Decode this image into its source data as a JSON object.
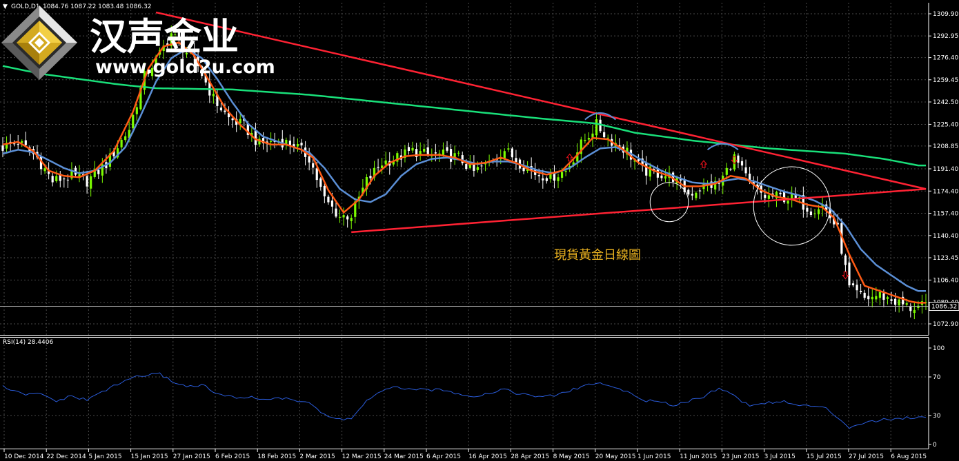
{
  "header": {
    "arrow": "▼",
    "symbol": "GOLD,D1",
    "ohlc": "1084.76 1087.22 1083.48 1086.32"
  },
  "brand": {
    "name_cn": "汉声金业",
    "url": "www.gold2u.com",
    "logo_icon": "diamond-logo-icon"
  },
  "annotation": {
    "text": "現貨黃金日線圖",
    "color": "#e8b020"
  },
  "rsi_header": "RSI(14) 28.4406",
  "current_price_label": "1086.32",
  "colors": {
    "bg": "#000000",
    "grid": "#4a4a4a",
    "bull": "#7cfc00",
    "bear": "#ffffff",
    "ma_fast": "#ff5a14",
    "ma_mid": "#5b8fd6",
    "ma_slow": "#19e07a",
    "trend": "#ff2233",
    "rsi": "#2a5cdc"
  },
  "chart_data": [
    {
      "type": "candlestick",
      "title": "",
      "x_tick_labels": [
        "10 Dec 2014",
        "22 Dec 2014",
        "5 Jan 2015",
        "15 Jan 2015",
        "27 Jan 2015",
        "6 Feb 2015",
        "18 Feb 2015",
        "2 Mar 2015",
        "12 Mar 2015",
        "24 Mar 2015",
        "6 Apr 2015",
        "16 Apr 2015",
        "28 Apr 2015",
        "8 May 2015",
        "20 May 2015",
        "1 Jun 2015",
        "11 Jun 2015",
        "23 Jun 2015",
        "3 Jul 2015",
        "15 Jul 2015",
        "27 Jul 2015",
        "6 Aug 2015"
      ],
      "y_tick_labels": [
        "1309.90",
        "1292.95",
        "1276.40",
        "1259.45",
        "1242.50",
        "1225.40",
        "1208.85",
        "1191.40",
        "1174.40",
        "1157.40",
        "1140.40",
        "1123.45",
        "1106.40",
        "1089.40",
        "1072.90"
      ],
      "ylim": [
        1066,
        1316
      ],
      "close_anchors": [
        {
          "x": 0,
          "y": 1208
        },
        {
          "x": 4,
          "y": 1212
        },
        {
          "x": 9,
          "y": 1200
        },
        {
          "x": 13,
          "y": 1182
        },
        {
          "x": 18,
          "y": 1186
        },
        {
          "x": 22,
          "y": 1182
        },
        {
          "x": 27,
          "y": 1195
        },
        {
          "x": 33,
          "y": 1222
        },
        {
          "x": 37,
          "y": 1262
        },
        {
          "x": 41,
          "y": 1279
        },
        {
          "x": 44,
          "y": 1295
        },
        {
          "x": 47,
          "y": 1284
        },
        {
          "x": 51,
          "y": 1270
        },
        {
          "x": 55,
          "y": 1245
        },
        {
          "x": 59,
          "y": 1230
        },
        {
          "x": 63,
          "y": 1224
        },
        {
          "x": 67,
          "y": 1210
        },
        {
          "x": 72,
          "y": 1213
        },
        {
          "x": 76,
          "y": 1210
        },
        {
          "x": 80,
          "y": 1200
        },
        {
          "x": 84,
          "y": 1168
        },
        {
          "x": 88,
          "y": 1155
        },
        {
          "x": 91,
          "y": 1156
        },
        {
          "x": 95,
          "y": 1182
        },
        {
          "x": 99,
          "y": 1196
        },
        {
          "x": 103,
          "y": 1200
        },
        {
          "x": 107,
          "y": 1205
        },
        {
          "x": 111,
          "y": 1202
        },
        {
          "x": 115,
          "y": 1202
        },
        {
          "x": 119,
          "y": 1200
        },
        {
          "x": 123,
          "y": 1189
        },
        {
          "x": 127,
          "y": 1196
        },
        {
          "x": 131,
          "y": 1206
        },
        {
          "x": 135,
          "y": 1196
        },
        {
          "x": 139,
          "y": 1188
        },
        {
          "x": 143,
          "y": 1185
        },
        {
          "x": 147,
          "y": 1190
        },
        {
          "x": 151,
          "y": 1210
        },
        {
          "x": 155,
          "y": 1225
        },
        {
          "x": 158,
          "y": 1215
        },
        {
          "x": 163,
          "y": 1205
        },
        {
          "x": 167,
          "y": 1190
        },
        {
          "x": 171,
          "y": 1188
        },
        {
          "x": 175,
          "y": 1185
        },
        {
          "x": 179,
          "y": 1172
        },
        {
          "x": 183,
          "y": 1178
        },
        {
          "x": 187,
          "y": 1180
        },
        {
          "x": 191,
          "y": 1200
        },
        {
          "x": 195,
          "y": 1180
        },
        {
          "x": 199,
          "y": 1170
        },
        {
          "x": 203,
          "y": 1170
        },
        {
          "x": 207,
          "y": 1168
        },
        {
          "x": 211,
          "y": 1160
        },
        {
          "x": 214,
          "y": 1164
        },
        {
          "x": 218,
          "y": 1145
        },
        {
          "x": 221,
          "y": 1100
        },
        {
          "x": 225,
          "y": 1092
        },
        {
          "x": 229,
          "y": 1095
        },
        {
          "x": 233,
          "y": 1090
        },
        {
          "x": 237,
          "y": 1085
        },
        {
          "x": 239,
          "y": 1086
        }
      ],
      "ma_fast_anchors": [
        {
          "x": 0,
          "y": 1210
        },
        {
          "x": 4,
          "y": 1212
        },
        {
          "x": 8,
          "y": 1205
        },
        {
          "x": 12,
          "y": 1190
        },
        {
          "x": 16,
          "y": 1186
        },
        {
          "x": 20,
          "y": 1185
        },
        {
          "x": 24,
          "y": 1190
        },
        {
          "x": 29,
          "y": 1205
        },
        {
          "x": 34,
          "y": 1235
        },
        {
          "x": 38,
          "y": 1268
        },
        {
          "x": 42,
          "y": 1285
        },
        {
          "x": 46,
          "y": 1288
        },
        {
          "x": 50,
          "y": 1278
        },
        {
          "x": 54,
          "y": 1258
        },
        {
          "x": 58,
          "y": 1238
        },
        {
          "x": 62,
          "y": 1225
        },
        {
          "x": 66,
          "y": 1214
        },
        {
          "x": 70,
          "y": 1210
        },
        {
          "x": 74,
          "y": 1210
        },
        {
          "x": 78,
          "y": 1206
        },
        {
          "x": 81,
          "y": 1200
        },
        {
          "x": 85,
          "y": 1175
        },
        {
          "x": 89,
          "y": 1158
        },
        {
          "x": 93,
          "y": 1168
        },
        {
          "x": 97,
          "y": 1186
        },
        {
          "x": 101,
          "y": 1196
        },
        {
          "x": 105,
          "y": 1201
        },
        {
          "x": 109,
          "y": 1202
        },
        {
          "x": 114,
          "y": 1202
        },
        {
          "x": 118,
          "y": 1200
        },
        {
          "x": 122,
          "y": 1195
        },
        {
          "x": 126,
          "y": 1196
        },
        {
          "x": 130,
          "y": 1200
        },
        {
          "x": 134,
          "y": 1196
        },
        {
          "x": 138,
          "y": 1190
        },
        {
          "x": 142,
          "y": 1187
        },
        {
          "x": 146,
          "y": 1190
        },
        {
          "x": 150,
          "y": 1202
        },
        {
          "x": 154,
          "y": 1215
        },
        {
          "x": 158,
          "y": 1214
        },
        {
          "x": 162,
          "y": 1206
        },
        {
          "x": 166,
          "y": 1196
        },
        {
          "x": 170,
          "y": 1190
        },
        {
          "x": 174,
          "y": 1186
        },
        {
          "x": 178,
          "y": 1178
        },
        {
          "x": 182,
          "y": 1178
        },
        {
          "x": 186,
          "y": 1180
        },
        {
          "x": 190,
          "y": 1186
        },
        {
          "x": 194,
          "y": 1184
        },
        {
          "x": 198,
          "y": 1175
        },
        {
          "x": 202,
          "y": 1170
        },
        {
          "x": 206,
          "y": 1168
        },
        {
          "x": 210,
          "y": 1164
        },
        {
          "x": 214,
          "y": 1162
        },
        {
          "x": 217,
          "y": 1154
        },
        {
          "x": 221,
          "y": 1126
        },
        {
          "x": 225,
          "y": 1102
        },
        {
          "x": 229,
          "y": 1098
        },
        {
          "x": 233,
          "y": 1094
        },
        {
          "x": 237,
          "y": 1090
        },
        {
          "x": 239,
          "y": 1089
        }
      ],
      "ma_mid_anchors": [
        {
          "x": 0,
          "y": 1203
        },
        {
          "x": 4,
          "y": 1206
        },
        {
          "x": 8,
          "y": 1204
        },
        {
          "x": 12,
          "y": 1198
        },
        {
          "x": 16,
          "y": 1192
        },
        {
          "x": 20,
          "y": 1188
        },
        {
          "x": 24,
          "y": 1190
        },
        {
          "x": 28,
          "y": 1196
        },
        {
          "x": 32,
          "y": 1208
        },
        {
          "x": 36,
          "y": 1232
        },
        {
          "x": 40,
          "y": 1258
        },
        {
          "x": 44,
          "y": 1276
        },
        {
          "x": 48,
          "y": 1283
        },
        {
          "x": 52,
          "y": 1276
        },
        {
          "x": 56,
          "y": 1260
        },
        {
          "x": 60,
          "y": 1242
        },
        {
          "x": 64,
          "y": 1226
        },
        {
          "x": 68,
          "y": 1216
        },
        {
          "x": 72,
          "y": 1212
        },
        {
          "x": 76,
          "y": 1208
        },
        {
          "x": 80,
          "y": 1204
        },
        {
          "x": 84,
          "y": 1192
        },
        {
          "x": 88,
          "y": 1176
        },
        {
          "x": 92,
          "y": 1168
        },
        {
          "x": 96,
          "y": 1166
        },
        {
          "x": 100,
          "y": 1172
        },
        {
          "x": 104,
          "y": 1186
        },
        {
          "x": 108,
          "y": 1195
        },
        {
          "x": 112,
          "y": 1199
        },
        {
          "x": 116,
          "y": 1200
        },
        {
          "x": 120,
          "y": 1198
        },
        {
          "x": 124,
          "y": 1195
        },
        {
          "x": 128,
          "y": 1197
        },
        {
          "x": 132,
          "y": 1197
        },
        {
          "x": 136,
          "y": 1194
        },
        {
          "x": 140,
          "y": 1190
        },
        {
          "x": 144,
          "y": 1188
        },
        {
          "x": 148,
          "y": 1192
        },
        {
          "x": 152,
          "y": 1200
        },
        {
          "x": 156,
          "y": 1207
        },
        {
          "x": 160,
          "y": 1208
        },
        {
          "x": 164,
          "y": 1203
        },
        {
          "x": 168,
          "y": 1196
        },
        {
          "x": 172,
          "y": 1190
        },
        {
          "x": 176,
          "y": 1185
        },
        {
          "x": 180,
          "y": 1181
        },
        {
          "x": 184,
          "y": 1180
        },
        {
          "x": 188,
          "y": 1182
        },
        {
          "x": 192,
          "y": 1184
        },
        {
          "x": 196,
          "y": 1182
        },
        {
          "x": 200,
          "y": 1178
        },
        {
          "x": 204,
          "y": 1174
        },
        {
          "x": 208,
          "y": 1171
        },
        {
          "x": 212,
          "y": 1167
        },
        {
          "x": 216,
          "y": 1161
        },
        {
          "x": 220,
          "y": 1148
        },
        {
          "x": 224,
          "y": 1130
        },
        {
          "x": 228,
          "y": 1118
        },
        {
          "x": 232,
          "y": 1110
        },
        {
          "x": 236,
          "y": 1102
        },
        {
          "x": 239,
          "y": 1098
        }
      ],
      "ma_slow_anchors": [
        {
          "x": 0,
          "y": 1270
        },
        {
          "x": 10,
          "y": 1264
        },
        {
          "x": 20,
          "y": 1260
        },
        {
          "x": 30,
          "y": 1256
        },
        {
          "x": 40,
          "y": 1253
        },
        {
          "x": 60,
          "y": 1252
        },
        {
          "x": 80,
          "y": 1248
        },
        {
          "x": 100,
          "y": 1242
        },
        {
          "x": 120,
          "y": 1236
        },
        {
          "x": 140,
          "y": 1230
        },
        {
          "x": 155,
          "y": 1226
        },
        {
          "x": 165,
          "y": 1219
        },
        {
          "x": 180,
          "y": 1213
        },
        {
          "x": 190,
          "y": 1210
        },
        {
          "x": 200,
          "y": 1207
        },
        {
          "x": 210,
          "y": 1205
        },
        {
          "x": 220,
          "y": 1203
        },
        {
          "x": 230,
          "y": 1199
        },
        {
          "x": 239,
          "y": 1194
        }
      ],
      "trendlines": [
        {
          "x1": 40,
          "y1": 1311,
          "x2": 241,
          "y2": 1176
        },
        {
          "x1": 91,
          "y1": 1143,
          "x2": 241,
          "y2": 1176
        }
      ],
      "ellipses": [
        {
          "cx": 174,
          "cy": 1166,
          "rx": 5,
          "ry": 15
        },
        {
          "cx": 206,
          "cy": 1163,
          "rx": 10,
          "ry": 30
        }
      ],
      "arcs": [
        {
          "x1": 152,
          "y1": 1229,
          "xm": 156,
          "ym": 1236,
          "x2": 160,
          "y2": 1229
        },
        {
          "x1": 184,
          "y1": 1206,
          "xm": 188,
          "ym": 1212,
          "x2": 192,
          "y2": 1206
        }
      ],
      "signal_arrows": [
        {
          "x": 148,
          "y": 1200,
          "dir": "up"
        },
        {
          "x": 183,
          "y": 1195,
          "dir": "up"
        },
        {
          "x": 191,
          "y": 1198,
          "dir": "down"
        },
        {
          "x": 220,
          "y": 1110,
          "dir": "down"
        }
      ]
    },
    {
      "type": "line",
      "title": "",
      "y_tick_labels": [
        "100",
        "70",
        "30",
        "0"
      ],
      "ylim": [
        0,
        100
      ],
      "values": [
        {
          "x": 0,
          "y": 60
        },
        {
          "x": 5,
          "y": 52
        },
        {
          "x": 10,
          "y": 52
        },
        {
          "x": 14,
          "y": 45
        },
        {
          "x": 18,
          "y": 50
        },
        {
          "x": 22,
          "y": 46
        },
        {
          "x": 26,
          "y": 55
        },
        {
          "x": 30,
          "y": 62
        },
        {
          "x": 34,
          "y": 70
        },
        {
          "x": 38,
          "y": 72
        },
        {
          "x": 41,
          "y": 73
        },
        {
          "x": 44,
          "y": 66
        },
        {
          "x": 48,
          "y": 60
        },
        {
          "x": 52,
          "y": 62
        },
        {
          "x": 56,
          "y": 52
        },
        {
          "x": 60,
          "y": 49
        },
        {
          "x": 64,
          "y": 49
        },
        {
          "x": 68,
          "y": 47
        },
        {
          "x": 72,
          "y": 48
        },
        {
          "x": 76,
          "y": 46
        },
        {
          "x": 80,
          "y": 44
        },
        {
          "x": 84,
          "y": 30
        },
        {
          "x": 88,
          "y": 26
        },
        {
          "x": 91,
          "y": 27
        },
        {
          "x": 95,
          "y": 45
        },
        {
          "x": 99,
          "y": 55
        },
        {
          "x": 103,
          "y": 60
        },
        {
          "x": 107,
          "y": 56
        },
        {
          "x": 111,
          "y": 57
        },
        {
          "x": 115,
          "y": 56
        },
        {
          "x": 119,
          "y": 53
        },
        {
          "x": 123,
          "y": 50
        },
        {
          "x": 127,
          "y": 53
        },
        {
          "x": 131,
          "y": 58
        },
        {
          "x": 135,
          "y": 52
        },
        {
          "x": 139,
          "y": 50
        },
        {
          "x": 143,
          "y": 50
        },
        {
          "x": 147,
          "y": 54
        },
        {
          "x": 151,
          "y": 60
        },
        {
          "x": 155,
          "y": 64
        },
        {
          "x": 158,
          "y": 61
        },
        {
          "x": 163,
          "y": 55
        },
        {
          "x": 167,
          "y": 46
        },
        {
          "x": 171,
          "y": 44
        },
        {
          "x": 175,
          "y": 41
        },
        {
          "x": 179,
          "y": 45
        },
        {
          "x": 183,
          "y": 50
        },
        {
          "x": 187,
          "y": 59
        },
        {
          "x": 191,
          "y": 50
        },
        {
          "x": 195,
          "y": 40
        },
        {
          "x": 199,
          "y": 43
        },
        {
          "x": 203,
          "y": 45
        },
        {
          "x": 207,
          "y": 41
        },
        {
          "x": 211,
          "y": 40
        },
        {
          "x": 215,
          "y": 37
        },
        {
          "x": 218,
          "y": 28
        },
        {
          "x": 221,
          "y": 18
        },
        {
          "x": 225,
          "y": 23
        },
        {
          "x": 229,
          "y": 25
        },
        {
          "x": 233,
          "y": 27
        },
        {
          "x": 237,
          "y": 28
        },
        {
          "x": 239,
          "y": 28
        }
      ]
    }
  ]
}
